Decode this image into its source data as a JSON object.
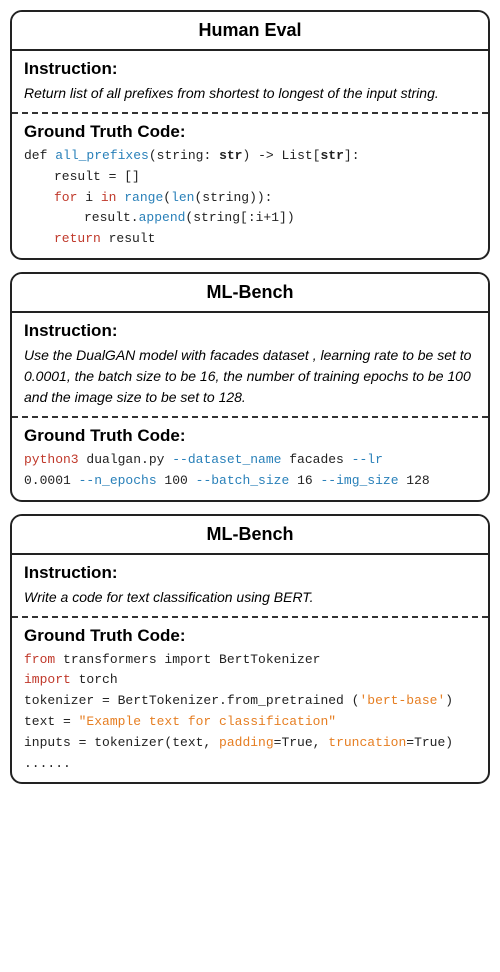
{
  "cards": [
    {
      "header": "Human Eval",
      "instruction_title": "Instruction:",
      "instruction_text": "Return list of all prefixes from shortest to longest of the input string.",
      "gt_title": "Ground Truth Code:",
      "code_type": "human_eval"
    },
    {
      "header": "ML-Bench",
      "instruction_title": "Instruction:",
      "instruction_text": "Use the DualGAN model with facades dataset , learning rate to be set to 0.0001, the batch size to be 16, the number of training epochs to be 100 and the image size to be set to 128.",
      "gt_title": "Ground Truth Code:",
      "code_type": "ml_bench_1"
    },
    {
      "header": "ML-Bench",
      "instruction_title": "Instruction:",
      "instruction_text": "Write a code for text classification using BERT.",
      "gt_title": "Ground Truth Code:",
      "code_type": "ml_bench_2"
    }
  ]
}
